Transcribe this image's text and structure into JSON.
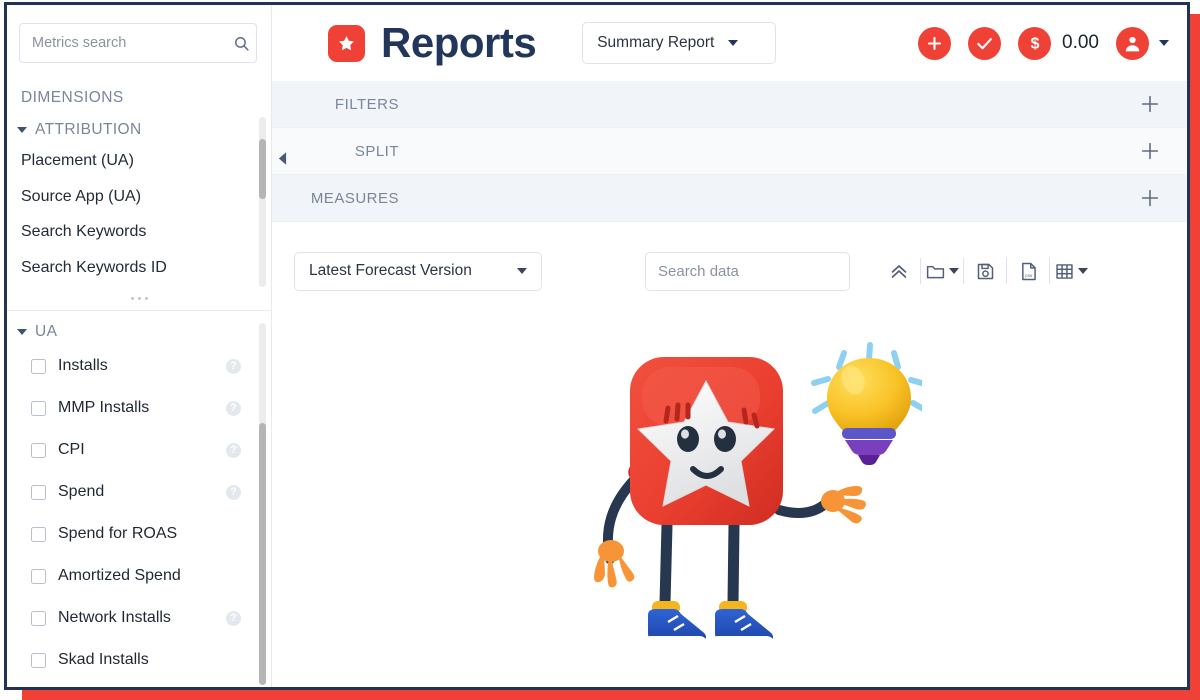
{
  "theme": {
    "brand_red": "#ef4136",
    "brand_navy": "#22355b",
    "panel_gray": "#f1f4f8",
    "muted_text": "#7a8799"
  },
  "sidebar": {
    "search": {
      "placeholder": "Metrics search",
      "value": "",
      "icon": "search-icon"
    },
    "dimensions": {
      "title": "DIMENSIONS",
      "groups": [
        {
          "label": "ATTRIBUTION",
          "expanded": true,
          "items": [
            {
              "label": "Placement (UA)"
            },
            {
              "label": "Source App (UA)"
            },
            {
              "label": "Search Keywords"
            },
            {
              "label": "Search Keywords ID"
            }
          ]
        }
      ]
    },
    "measures": {
      "groups": [
        {
          "label": "UA",
          "expanded": true,
          "items": [
            {
              "label": "Installs",
              "checked": false,
              "help": true
            },
            {
              "label": "MMP Installs",
              "checked": false,
              "help": true
            },
            {
              "label": "CPI",
              "checked": false,
              "help": true
            },
            {
              "label": "Spend",
              "checked": false,
              "help": true
            },
            {
              "label": "Spend for ROAS",
              "checked": false,
              "help": false
            },
            {
              "label": "Amortized Spend",
              "checked": false,
              "help": false
            },
            {
              "label": "Network Installs",
              "checked": false,
              "help": true
            },
            {
              "label": "Skad Installs",
              "checked": false,
              "help": false
            }
          ]
        }
      ]
    },
    "collapse_icon": "chevron-left-icon",
    "help_glyph": "?"
  },
  "topbar": {
    "logo_icon": "star-logo-icon",
    "title": "Reports",
    "report_type": {
      "selected": "Summary Report",
      "caret_icon": "chevron-down-icon"
    },
    "actions": [
      {
        "name": "add-button",
        "icon": "plus-circle-icon"
      },
      {
        "name": "approve-button",
        "icon": "check-circle-icon"
      },
      {
        "name": "balance-button",
        "icon": "dollar-circle-icon"
      }
    ],
    "balance_value": "0.00",
    "user_menu": {
      "icon": "user-avatar-icon",
      "caret_icon": "chevron-down-icon"
    }
  },
  "panels": [
    {
      "label": "FILTERS",
      "add_icon": "plus-icon",
      "indent": 0
    },
    {
      "label": "SPLIT",
      "add_icon": "plus-icon",
      "indent": 0
    },
    {
      "label": "MEASURES",
      "add_icon": "plus-icon",
      "indent": 0
    }
  ],
  "toolbar": {
    "forecast_select": {
      "selected": "Latest Forecast Version",
      "caret_icon": "chevron-down-icon"
    },
    "data_search": {
      "placeholder": "Search data",
      "value": "",
      "icon": "search-icon"
    },
    "buttons": [
      {
        "name": "collapse-all-button",
        "icon": "double-chevron-up-icon",
        "caret": false
      },
      {
        "name": "folder-button",
        "icon": "folder-icon",
        "caret": true
      },
      {
        "name": "save-button",
        "icon": "floppy-disk-icon",
        "caret": false
      },
      {
        "name": "export-csv-button",
        "icon": "csv-file-icon",
        "caret": false,
        "badge": "csv"
      },
      {
        "name": "table-view-button",
        "icon": "table-grid-icon",
        "caret": true
      }
    ]
  },
  "content": {
    "illustration": "star-mascot-with-lightbulb-illustration",
    "empty_state_text": ""
  }
}
